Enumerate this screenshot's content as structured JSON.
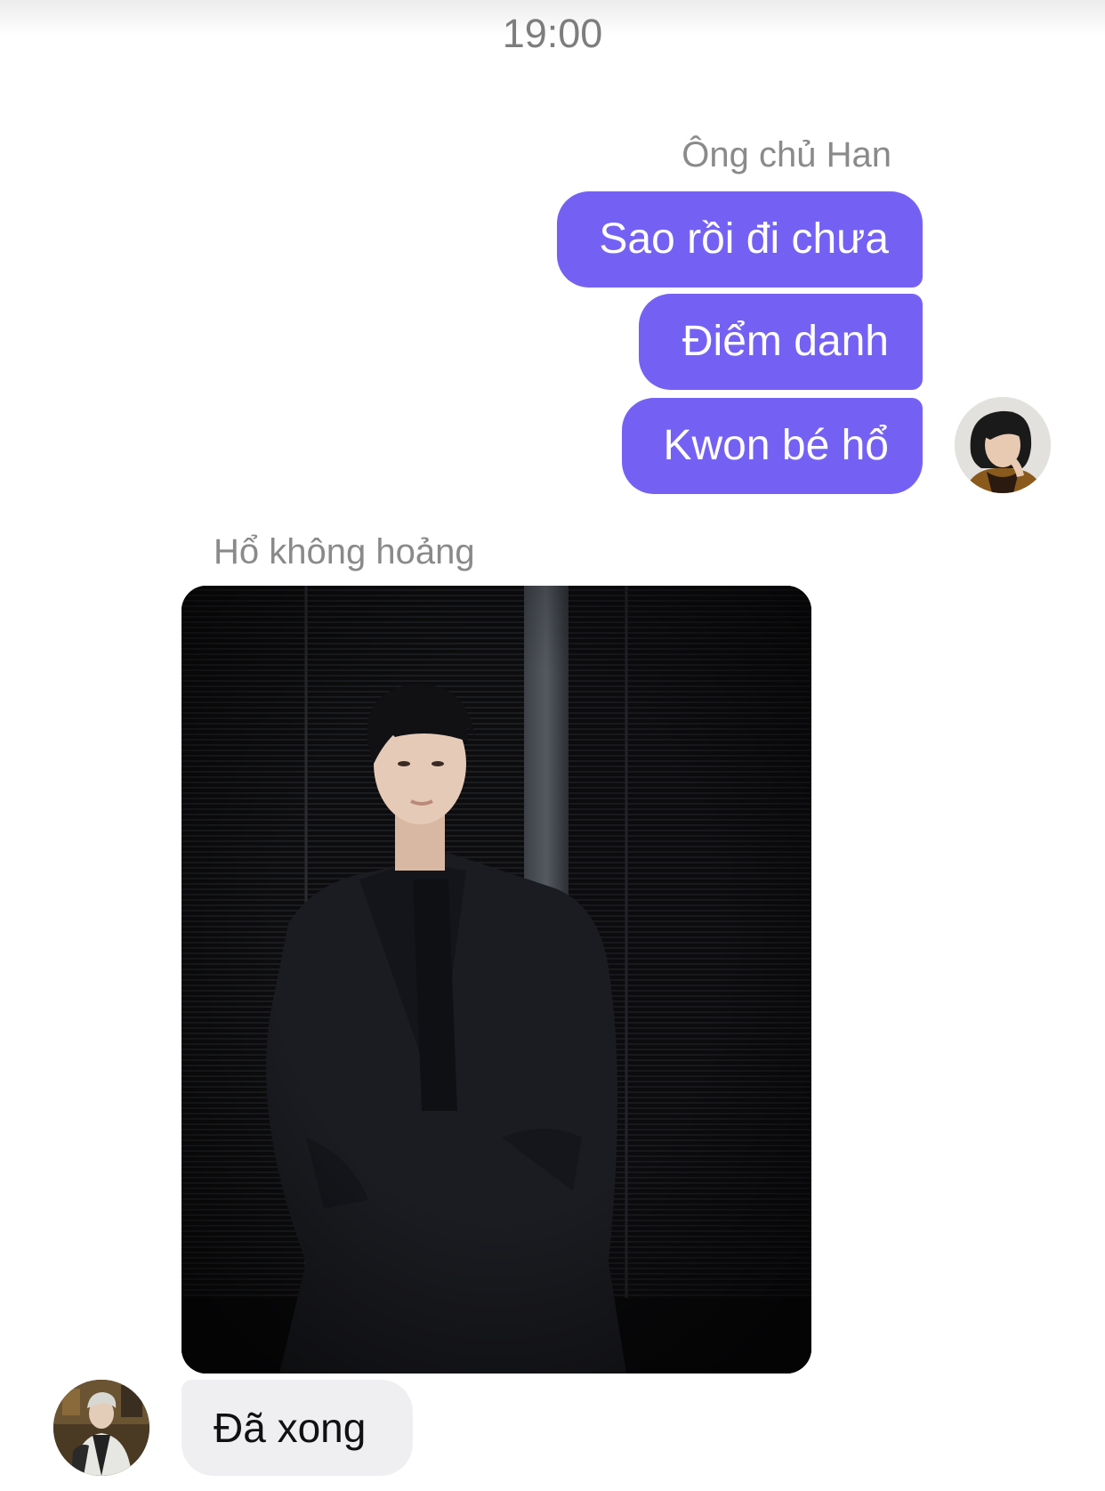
{
  "timestamp": "19:00",
  "outgoing": {
    "sender_name": "Ông chủ Han",
    "messages": [
      "Sao rồi đi chưa",
      "Điểm danh",
      "Kwon bé hổ"
    ],
    "bubble_color": "#7461f4",
    "avatar_icon": "profile-photo-avatar"
  },
  "incoming": {
    "sender_name": "Hổ không hoảng",
    "photo_icon": "shared-photo-man-in-black-suit",
    "messages": [
      "Đã xong"
    ],
    "bubble_color": "#efeff1",
    "avatar_icon": "profile-photo-avatar"
  }
}
